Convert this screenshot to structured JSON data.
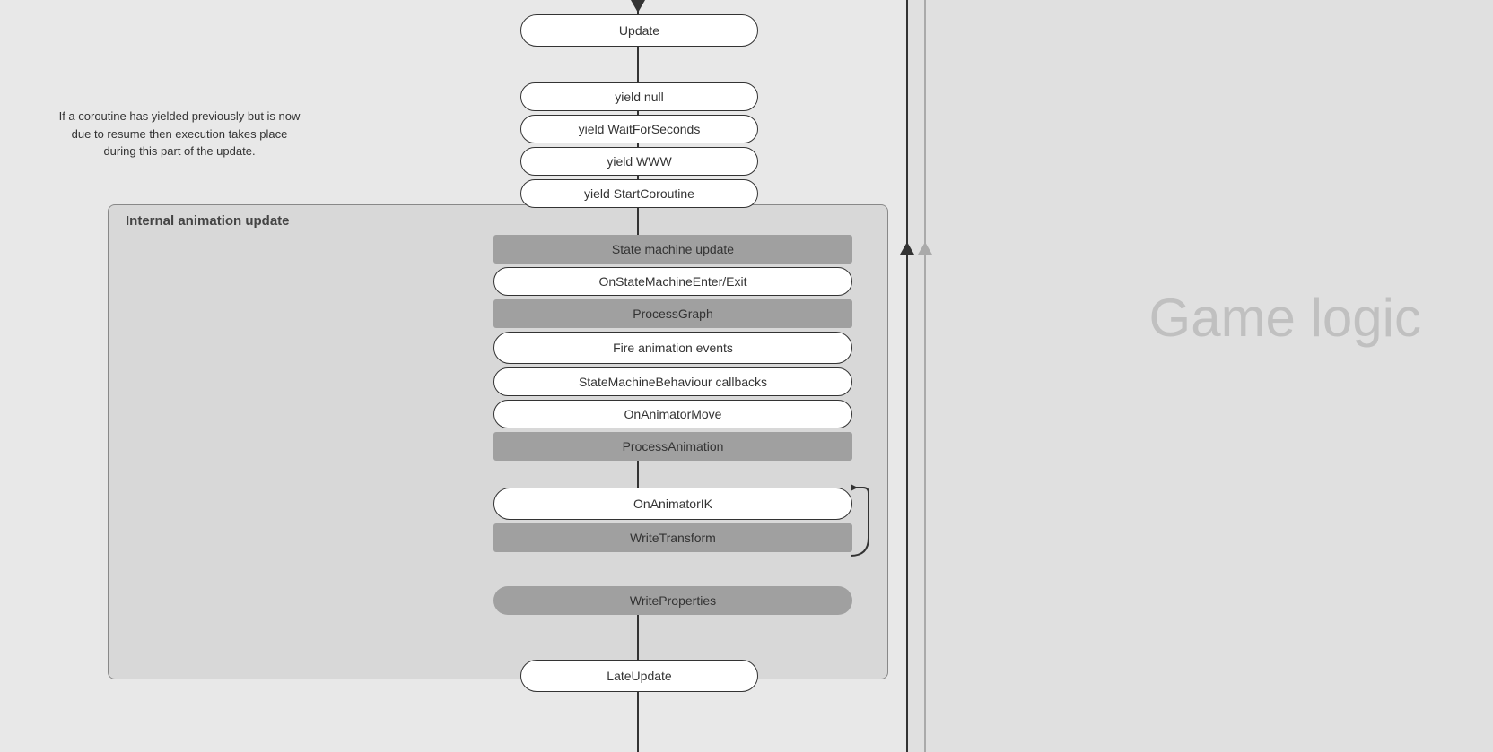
{
  "annotation": {
    "text": "If a coroutine has yielded previously but is now due to resume then execution takes place during this part of the update."
  },
  "game_logic": {
    "label": "Game logic"
  },
  "nodes": {
    "update": "Update",
    "yield_null": "yield null",
    "yield_waitforseconds": "yield WaitForSeconds",
    "yield_www": "yield WWW",
    "yield_startcoroutine": "yield StartCoroutine",
    "state_machine_update": "State machine update",
    "on_state_machine": "OnStateMachineEnter/Exit",
    "process_graph": "ProcessGraph",
    "fire_animation_events": "Fire animation events",
    "state_machine_behaviour": "StateMachineBehaviour callbacks",
    "on_animator_move": "OnAnimatorMove",
    "process_animation": "ProcessAnimation",
    "on_animator_ik": "OnAnimatorIK",
    "write_transform": "WriteTransform",
    "write_properties": "WriteProperties",
    "late_update": "LateUpdate"
  },
  "labels": {
    "internal_animation_update": "Internal animation update"
  }
}
